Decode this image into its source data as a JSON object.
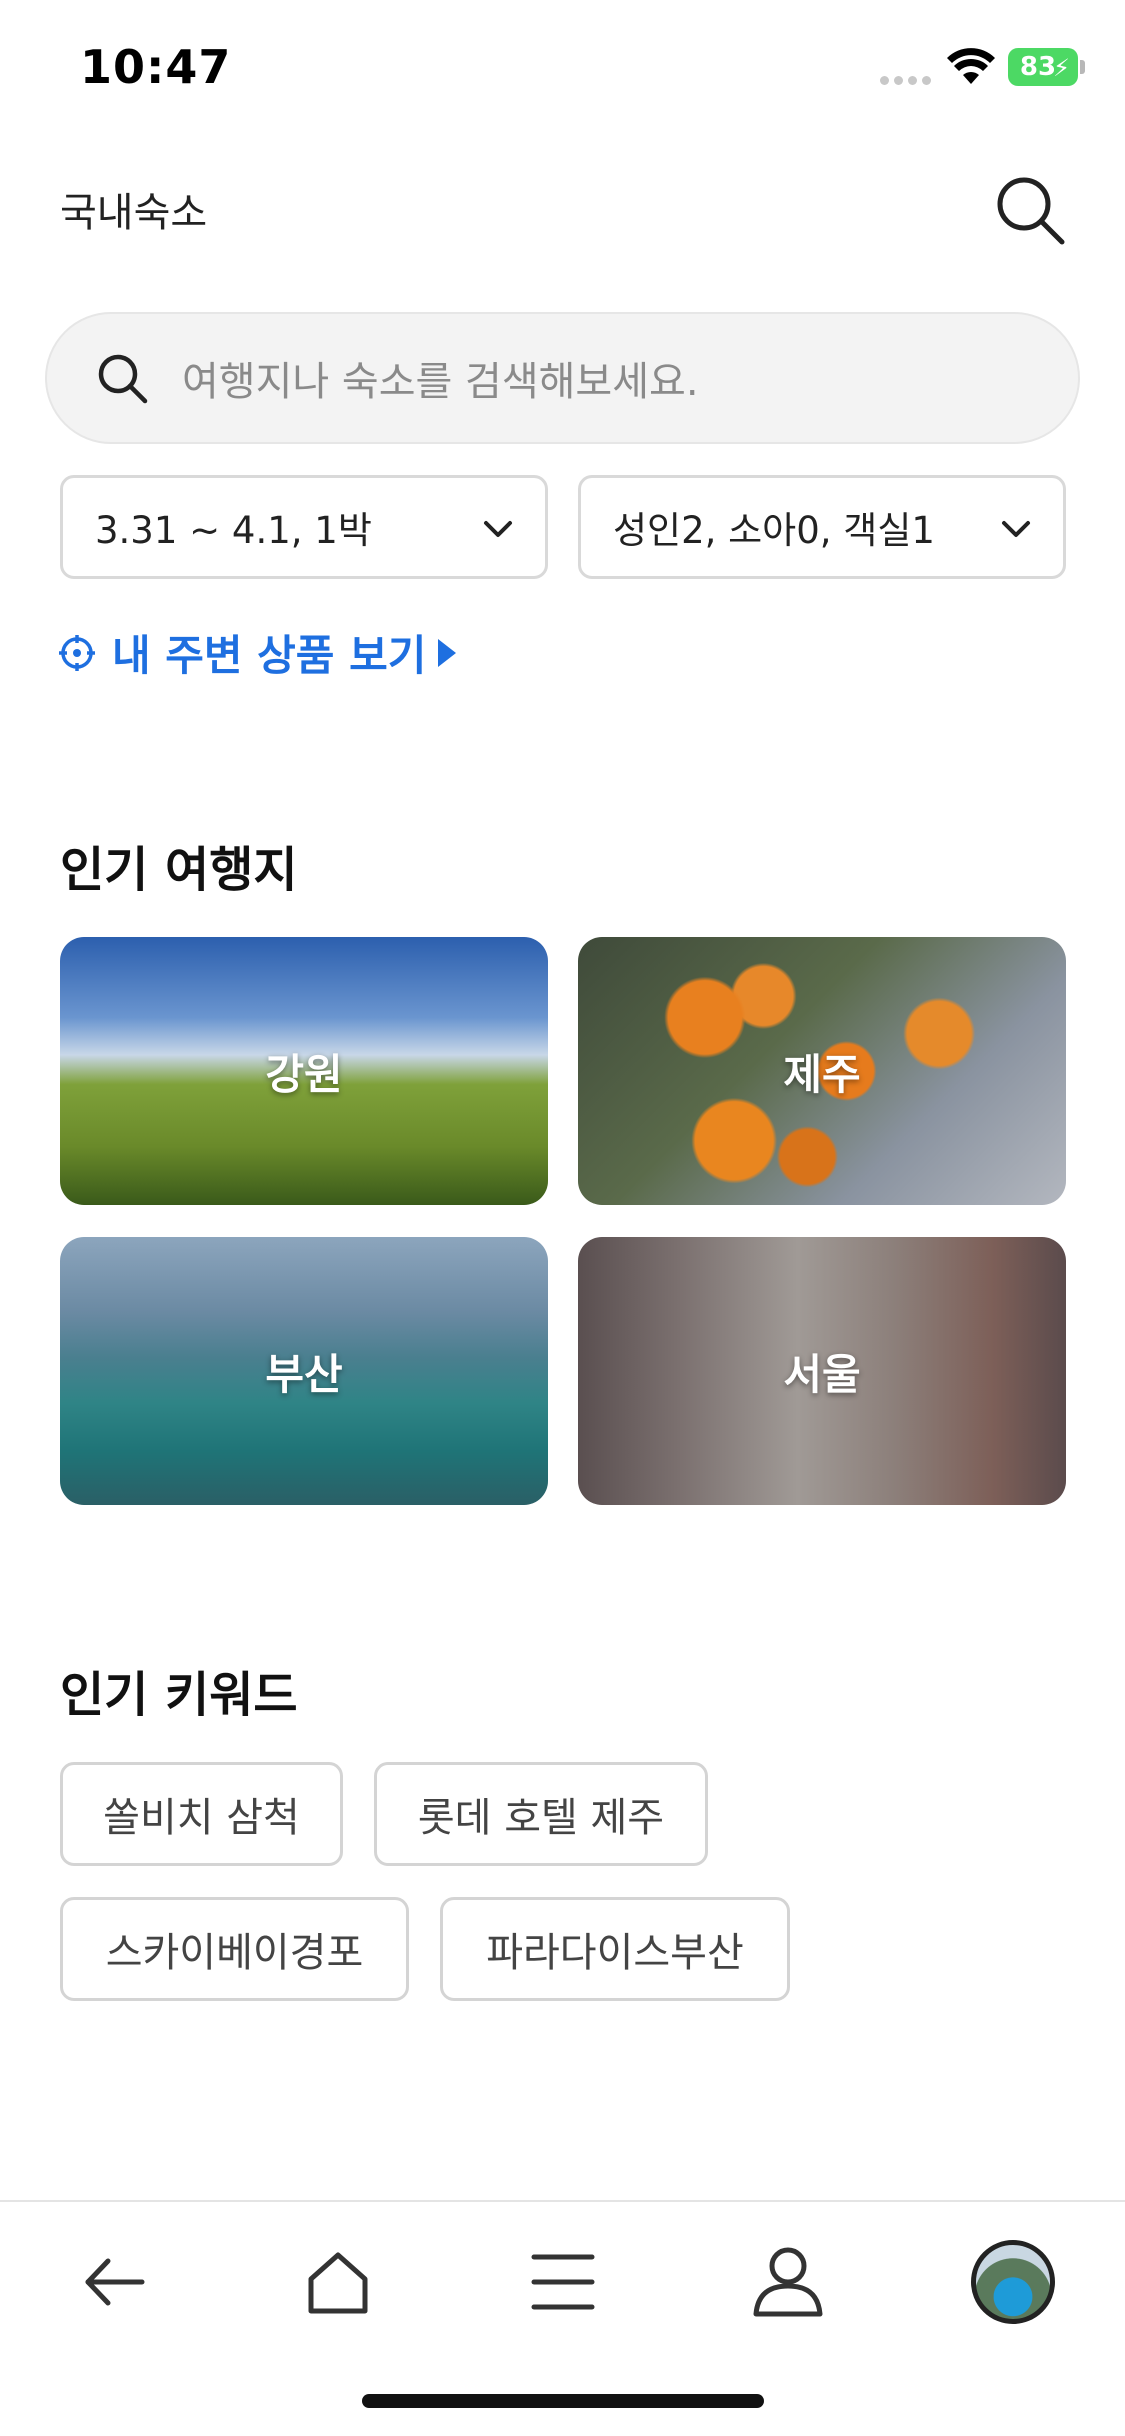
{
  "status_bar": {
    "time": "10:47",
    "battery": "83"
  },
  "header": {
    "title": "국내숙소"
  },
  "search": {
    "placeholder": "여행지나 숙소를 검색해보세요."
  },
  "filters": {
    "dates": "3.31 ~ 4.1, 1박",
    "guests": "성인2, 소아0, 객실1"
  },
  "nearby": {
    "label": "내 주변 상품 보기"
  },
  "popular_destinations": {
    "title": "인기 여행지",
    "items": [
      {
        "label": "강원"
      },
      {
        "label": "제주"
      },
      {
        "label": "부산"
      },
      {
        "label": "서울"
      }
    ]
  },
  "popular_keywords": {
    "title": "인기 키워드",
    "items": [
      {
        "label": "쏠비치 삼척"
      },
      {
        "label": "롯데 호텔 제주"
      },
      {
        "label": "스카이베이경포"
      },
      {
        "label": "파라다이스부산"
      }
    ]
  },
  "bottom_nav": {
    "items": [
      {
        "icon": "back-arrow-icon"
      },
      {
        "icon": "home-icon"
      },
      {
        "icon": "menu-icon"
      },
      {
        "icon": "user-icon"
      },
      {
        "icon": "profile-avatar"
      }
    ]
  },
  "colors": {
    "accent": "#1e6fe0",
    "battery": "#4cd964"
  }
}
